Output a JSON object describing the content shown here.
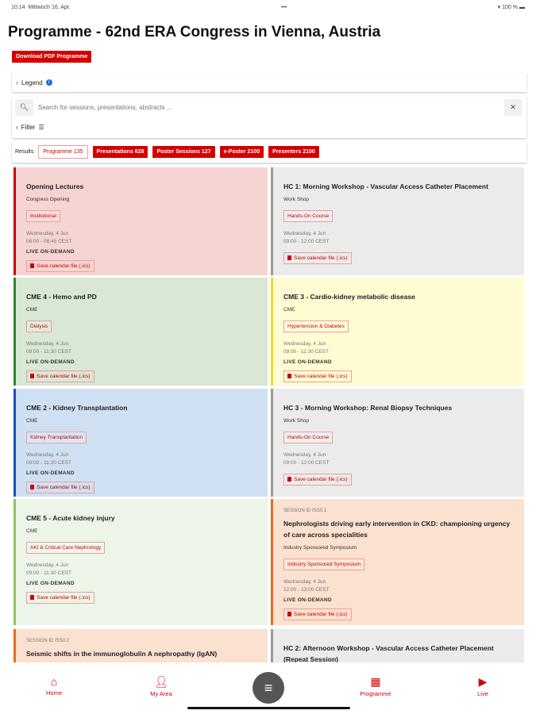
{
  "status": {
    "time": "10:14",
    "date": "Mittwoch 16. Apr.",
    "battery": "100 %"
  },
  "title": "Programme - 62nd ERA Congress in Vienna, Austria",
  "download_label": "Download PDF Programme",
  "legend_label": "Legend",
  "search": {
    "placeholder": "Search for sessions, presentations, abstracts ..."
  },
  "filter_label": "Filter",
  "results": {
    "label": "Results",
    "chips": [
      "Programme 135",
      "Presentations 628",
      "Poster Sessions 127",
      "e-Poster 2100",
      "Presenters 2100"
    ]
  },
  "calendar_label": "Save calendar file (.ics)",
  "cards": [
    {
      "title": "Opening Lectures",
      "type": "Congress Opening",
      "tag": "Institutional",
      "date": "Wednesday, 4 Jun",
      "time": "08:00 - 08:45 CEST",
      "live": "LIVE  ON-DEMAND",
      "bg": "#f6d4d1",
      "border": "#cc0000"
    },
    {
      "title": "HC 1: Morning Workshop - Vascular Access Catheter Placement",
      "type": "Work Shop",
      "tag": "Hands-On Course",
      "date": "Wednesday, 4 Jun",
      "time": "09:00 - 12:00 CEST",
      "bg": "#ebebeb",
      "border": "#999999"
    },
    {
      "title": "CME 4 - Hemo and PD",
      "type": "CME",
      "tag": "Dialysis",
      "date": "Wednesday, 4 Jun",
      "time": "09:00 - 11:30 CEST",
      "live": "LIVE  ON-DEMAND",
      "bg": "#d9e7d5",
      "border": "#2a8a2a"
    },
    {
      "title": "CME 3 - Cardio-kidney metabolic disease",
      "type": "CME",
      "tag": "Hypertension & Diabetes",
      "date": "Wednesday, 4 Jun",
      "time": "09:00 - 11:30 CEST",
      "live": "LIVE  ON-DEMAND",
      "bg": "#fffbd2",
      "border": "#f0dc20"
    },
    {
      "title": "CME 2 - Kidney Transplantation",
      "type": "CME",
      "tag": "Kidney Transplantation",
      "date": "Wednesday, 4 Jun",
      "time": "09:00 - 11:30 CEST",
      "live": "LIVE  ON-DEMAND",
      "bg": "#cfe0f2",
      "border": "#1a4fc0"
    },
    {
      "title": "HC 3 - Morning Workshop: Renal Biopsy Techniques",
      "type": "Work Shop",
      "tag": "Hands-On Course",
      "date": "Wednesday, 4 Jun",
      "time": "09:00 - 12:00 CEST",
      "bg": "#ebebeb",
      "border": "#999999"
    },
    {
      "title": "CME 5 - Acute kidney injury",
      "type": "CME",
      "tag": "AKI & Critical Care Nephrology",
      "date": "Wednesday, 4 Jun",
      "time": "09:00 - 11:30 CEST",
      "live": "LIVE  ON-DEMAND",
      "bg": "#ecf5e8",
      "border": "#8cc46a"
    },
    {
      "session_id": "SESSION ID ISS0.1",
      "title": "Nephrologists driving early intervention in CKD: championing urgency of care across specialities",
      "type": "Industry Sponsored Symposium",
      "tag": "Industry Sponsored Symposium",
      "date": "Wednesday, 4 Jun",
      "time": "12:00 - 13:00 CEST",
      "live": "LIVE  ON-DEMAND",
      "bg": "#fbe1cf",
      "border": "#ec6a1f"
    },
    {
      "session_id": "SESSION ID ISS0.2",
      "title": "Seismic shifts in the immunoglobulin A nephropathy (IgAN)",
      "bg": "#fbe1cf",
      "border": "#ec6a1f"
    },
    {
      "title": "HC 2: Afternoon Workshop - Vascular Access Catheter Placement (Repeat Session)",
      "bg": "#ebebeb",
      "border": "#999999"
    }
  ],
  "nav": [
    {
      "label": "Home",
      "icon": "home-icon"
    },
    {
      "label": "My Area",
      "icon": "user-icon"
    },
    {
      "label": "Programme",
      "icon": "calendar-icon"
    },
    {
      "label": "Live",
      "icon": "live-icon"
    }
  ]
}
